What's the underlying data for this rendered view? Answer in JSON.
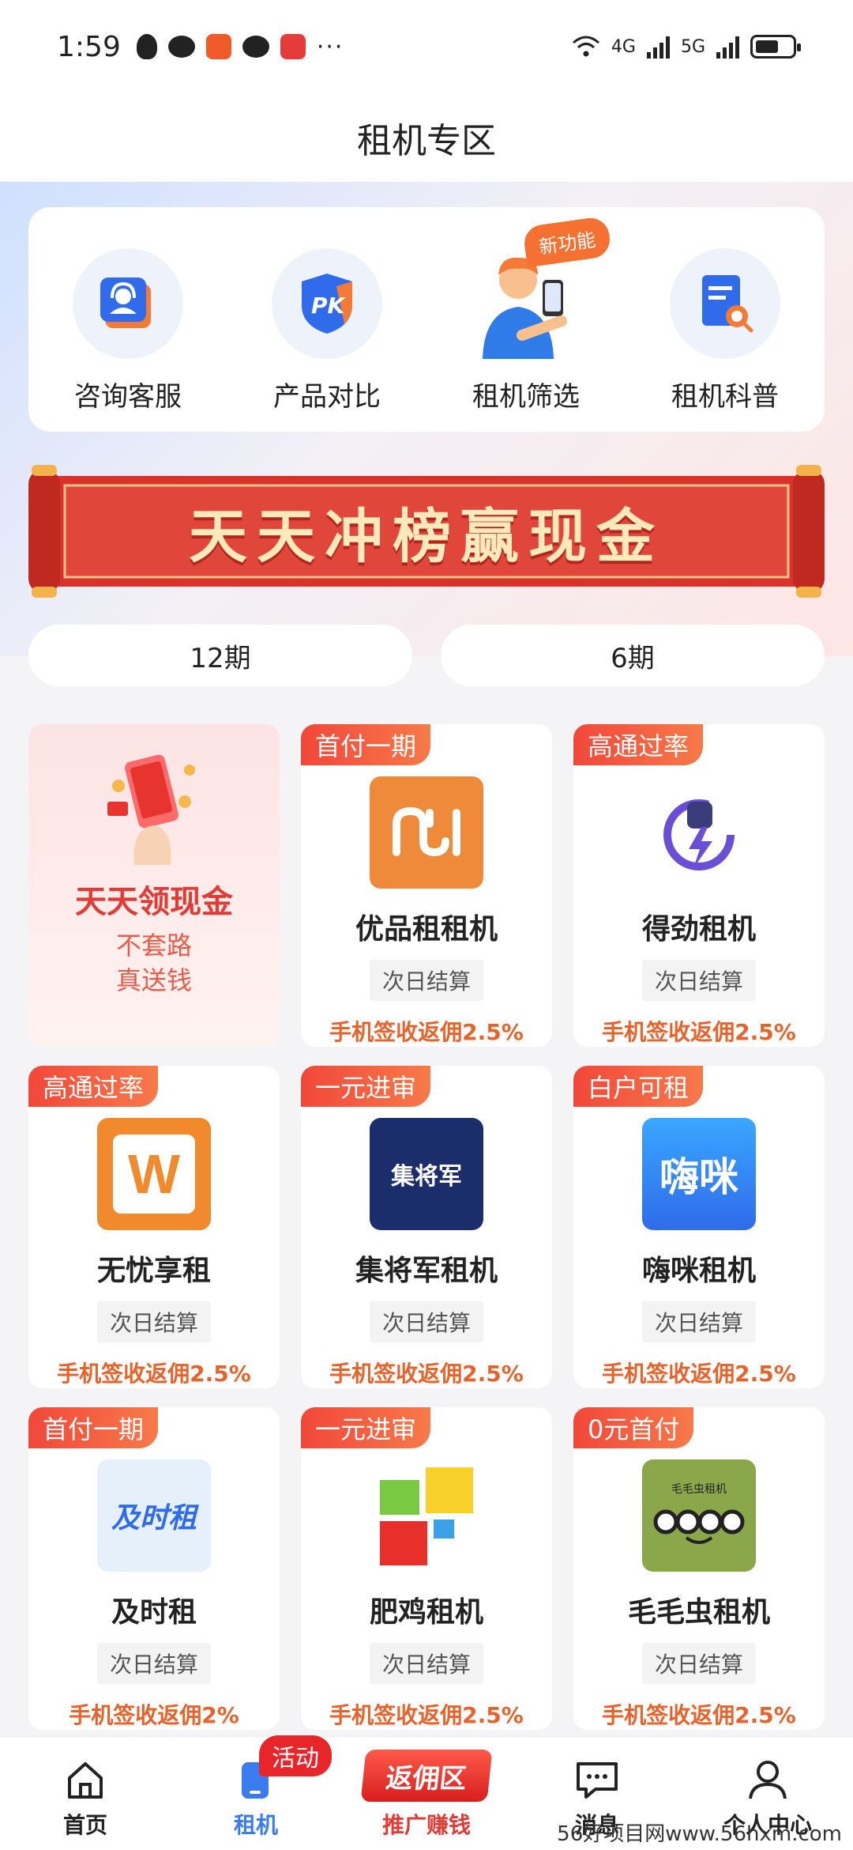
{
  "status_bar": {
    "time": "1:59",
    "more": "···",
    "net1": "4G",
    "net2": "5G"
  },
  "header": {
    "title": "租机专区"
  },
  "quick_entries": [
    {
      "label": "咨询客服",
      "icon": "customer-service-icon"
    },
    {
      "label": "产品对比",
      "icon": "pk-compare-icon"
    },
    {
      "label": "租机筛选",
      "icon": "person-phone-icon",
      "badge": "新功能"
    },
    {
      "label": "租机科普",
      "icon": "document-search-icon"
    }
  ],
  "banner": {
    "title": "天天冲榜赢现金"
  },
  "period_tabs": [
    "12期",
    "6期"
  ],
  "promo_card": {
    "title": "天天领现金",
    "line1": "不套路",
    "line2": "真送钱"
  },
  "products": [
    {
      "tag": "首付一期",
      "name": "优品租租机",
      "settle": "次日结算",
      "rebate": "手机签收返佣2.5%",
      "logo_color": "#ee8a3a",
      "logo_text": ""
    },
    {
      "tag": "高通过率",
      "name": "得劲租机",
      "settle": "次日结算",
      "rebate": "手机签收返佣2.5%",
      "logo_color": "#ffffff",
      "logo_text": ""
    },
    {
      "tag": "高通过率",
      "name": "无忧享租",
      "settle": "次日结算",
      "rebate": "手机签收返佣2.5%",
      "logo_color": "#f08a2c",
      "logo_text": "W"
    },
    {
      "tag": "一元进审",
      "name": "集将军租机",
      "settle": "次日结算",
      "rebate": "手机签收返佣2.5%",
      "logo_color": "#1c2d6b",
      "logo_text": "集将军"
    },
    {
      "tag": "白户可租",
      "name": "嗨咪租机",
      "settle": "次日结算",
      "rebate": "手机签收返佣2.5%",
      "logo_color": "#2f7ff5",
      "logo_text": "嗨咪"
    },
    {
      "tag": "首付一期",
      "name": "及时租",
      "settle": "次日结算",
      "rebate": "手机签收返佣2%",
      "logo_color": "#e6f0fb",
      "logo_text": "及时租"
    },
    {
      "tag": "一元进审",
      "name": "肥鸡租机",
      "settle": "次日结算",
      "rebate": "手机签收返佣2.5%",
      "logo_color": "#ffffff",
      "logo_text": ""
    },
    {
      "tag": "0元首付",
      "name": "毛毛虫租机",
      "settle": "次日结算",
      "rebate": "手机签收返佣2.5%",
      "logo_color": "#8aa84a",
      "logo_text": "毛毛虫租机"
    }
  ],
  "bottom_nav": [
    {
      "label": "首页",
      "icon": "home-icon"
    },
    {
      "label": "租机",
      "icon": "phone-icon",
      "badge": "活动"
    },
    {
      "label": "推广赚钱",
      "icon": "rebate-zone-icon",
      "pill": "返佣区"
    },
    {
      "label": "消息",
      "icon": "message-icon"
    },
    {
      "label": "个人中心",
      "icon": "user-icon"
    }
  ],
  "watermark": "56好项目网www.56hxm.com"
}
